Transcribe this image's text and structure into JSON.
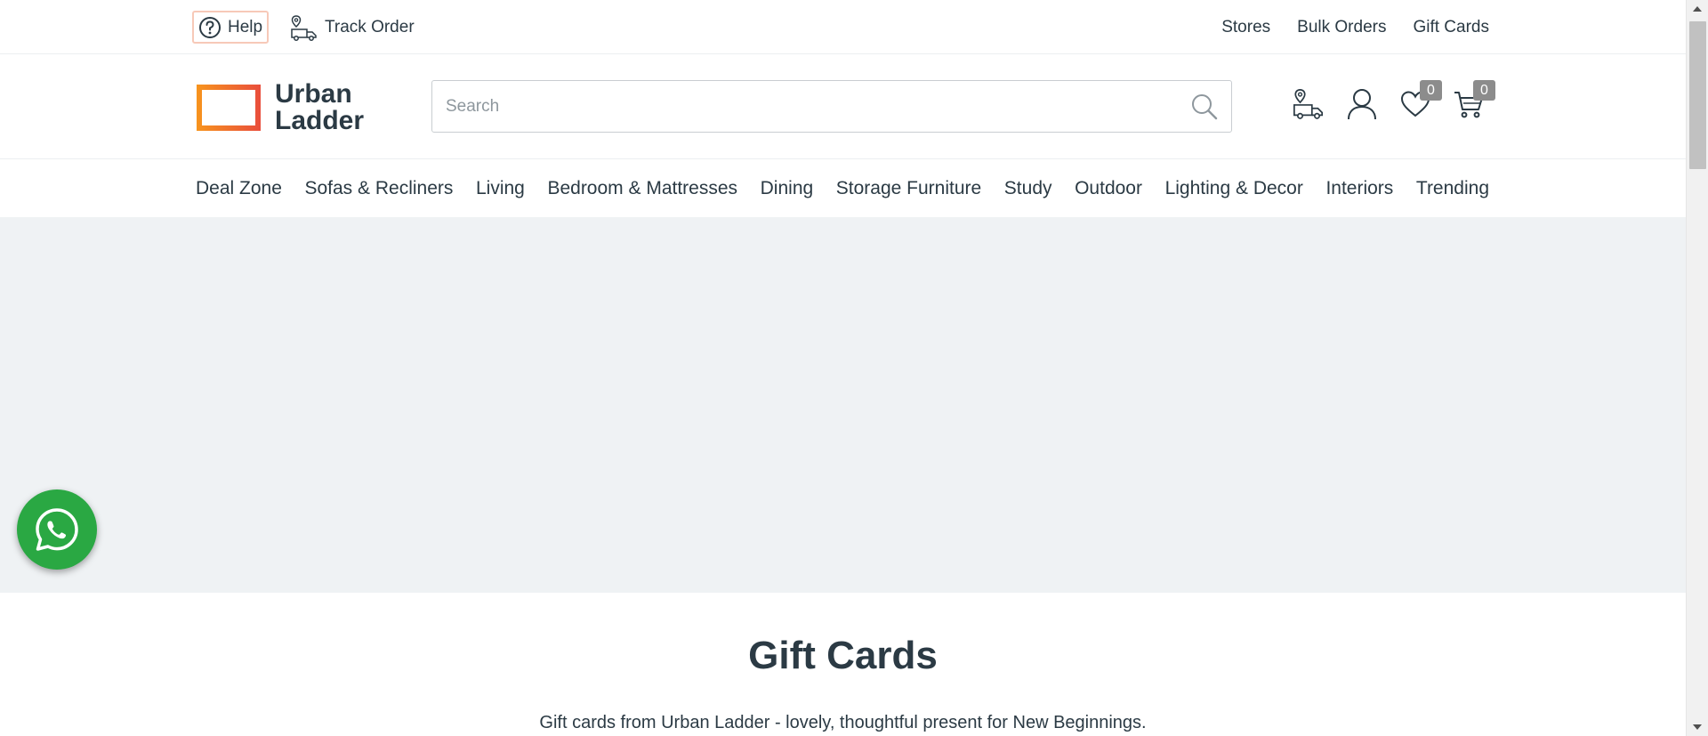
{
  "utility_bar": {
    "help_label": "Help",
    "track_order_label": "Track Order",
    "links": [
      "Stores",
      "Bulk Orders",
      "Gift Cards"
    ]
  },
  "header": {
    "logo_line1": "Urban",
    "logo_line2": "Ladder",
    "search_placeholder": "Search",
    "wishlist_count": "0",
    "cart_count": "0"
  },
  "category_nav": [
    "Deal Zone",
    "Sofas & Recliners",
    "Living",
    "Bedroom & Mattresses",
    "Dining",
    "Storage Furniture",
    "Study",
    "Outdoor",
    "Lighting & Decor",
    "Interiors",
    "Trending"
  ],
  "main": {
    "title": "Gift Cards",
    "description": "Gift cards from Urban Ladder - lovely, thoughtful present for New Beginnings."
  },
  "colors": {
    "text": "#2b3a44",
    "banner_bg": "#eff2f4",
    "whatsapp": "#2aa843",
    "logo_gradient_start": "#f7941d",
    "logo_gradient_end": "#e94e3c",
    "badge": "#8c8c8c"
  },
  "icons": {
    "help": "question-circle-icon",
    "track_order": "delivery-truck-icon",
    "search": "magnifier-icon",
    "store_locator": "location-truck-icon",
    "profile": "user-icon",
    "wishlist": "heart-icon",
    "cart": "cart-icon",
    "whatsapp": "whatsapp-icon"
  }
}
